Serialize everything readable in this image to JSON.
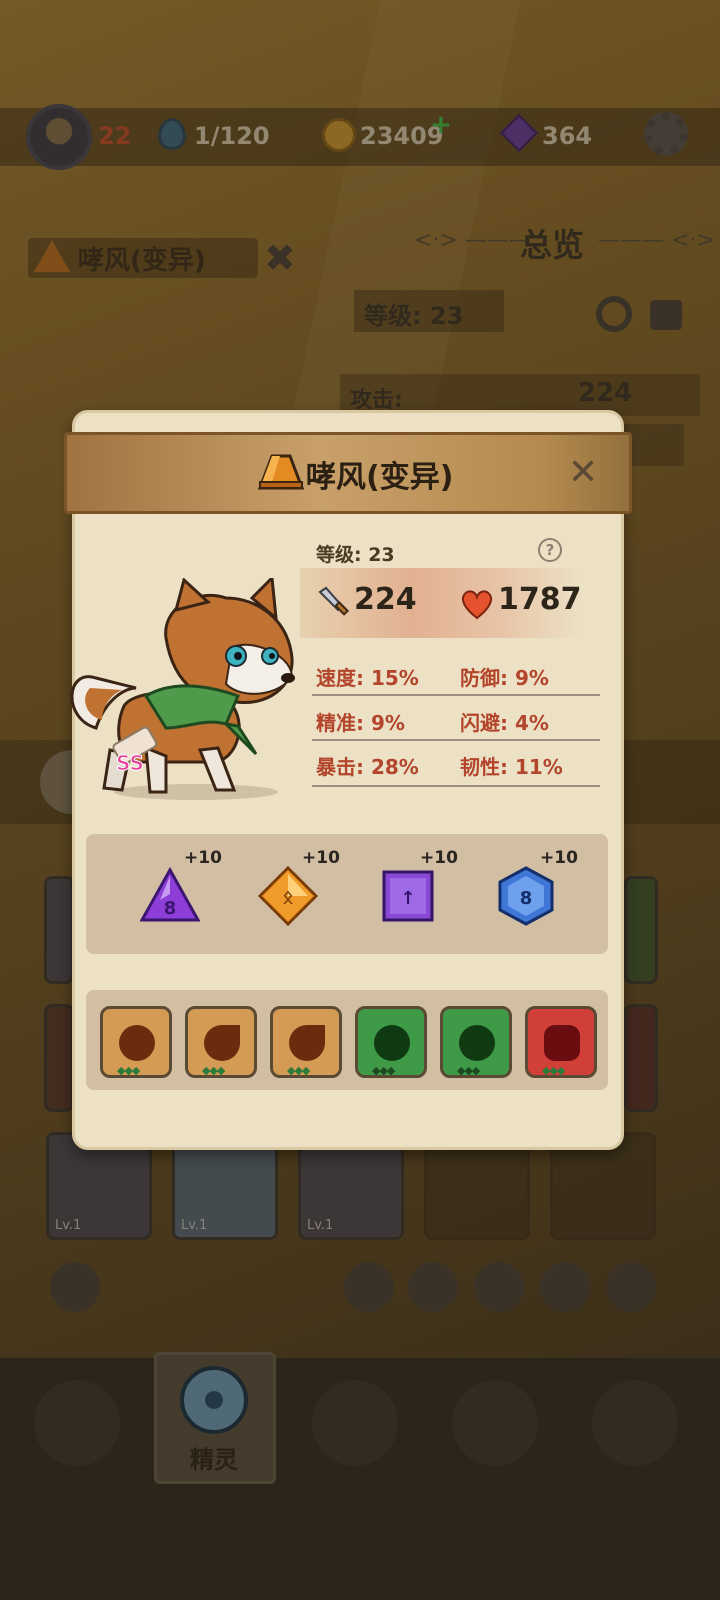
{
  "topbar": {
    "level": "22",
    "energy": "1/120",
    "coins": "23409",
    "coin_plus": "+",
    "gems": "364"
  },
  "background": {
    "spirit_name": "哮风(变异)",
    "overview_title": "总览",
    "level_label": "等级: 23",
    "attack_label": "攻击:",
    "attack_value": "224",
    "nav_spirit_label": "精灵",
    "card_level": "Lv.1"
  },
  "modal": {
    "title": "哮风(变异)",
    "close_label": "✕",
    "level_label": "等级: 23",
    "help_label": "?",
    "attack": "224",
    "hp": "1787",
    "rank_badge": "SS",
    "attributes": [
      {
        "label": "速度: 15%"
      },
      {
        "label": "防御: 9%"
      },
      {
        "label": "精准: 9%"
      },
      {
        "label": "闪避: 4%"
      },
      {
        "label": "暴击: 28%"
      },
      {
        "label": "韧性: 11%"
      }
    ],
    "gems": [
      {
        "plus": "+10",
        "symbol": "8",
        "icon": "triangle-gem-icon",
        "color": "#8e3ed8"
      },
      {
        "plus": "+10",
        "symbol": "ᛟ",
        "icon": "diamond-gem-icon",
        "color": "#f09a2a"
      },
      {
        "plus": "+10",
        "symbol": "↑",
        "icon": "square-gem-icon",
        "color": "#8848d6"
      },
      {
        "plus": "+10",
        "symbol": "8",
        "icon": "hexagon-gem-icon",
        "color": "#3f77d6"
      }
    ],
    "skills": [
      {
        "icon": "earth-orb-skill-icon",
        "color": "#d39b53",
        "blob": "#6b2c0e",
        "dots": "◆◆◆"
      },
      {
        "icon": "earth-leaf-skill-icon",
        "color": "#d39b53",
        "blob": "#6b2c0e",
        "dots": "◆◆◆"
      },
      {
        "icon": "earth-leaf-skill-icon",
        "color": "#d39b53",
        "blob": "#6b2c0e",
        "dots": "◆◆◆"
      },
      {
        "icon": "wind-burst-skill-icon",
        "color": "#3f9a47",
        "blob": "#0f3a12",
        "dots": "◆◆◆"
      },
      {
        "icon": "wind-burst-skill-icon",
        "color": "#3f9a47",
        "blob": "#0f3a12",
        "dots": "◆◆◆"
      },
      {
        "icon": "fang-bite-skill-icon",
        "color": "#d04038",
        "blob": "#6a0d10",
        "dots": "◆◆◆"
      }
    ]
  }
}
